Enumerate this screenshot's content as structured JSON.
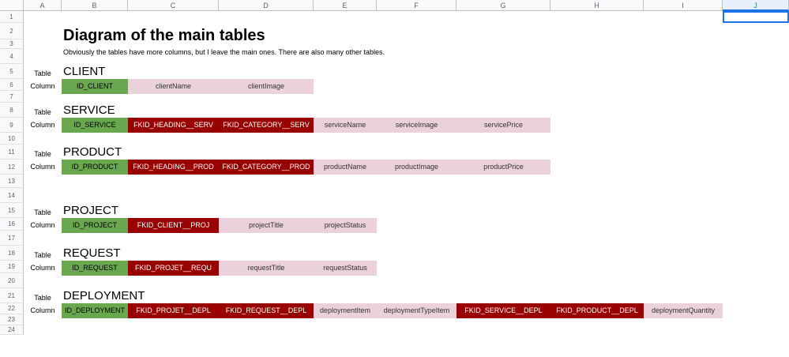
{
  "spreadsheet": {
    "columns": [
      "A",
      "B",
      "C",
      "D",
      "E",
      "F",
      "G",
      "H",
      "I",
      "J"
    ],
    "rows": [
      "1",
      "2",
      "3",
      "4",
      "5",
      "6",
      "7",
      "8",
      "9",
      "10",
      "11",
      "12",
      "13",
      "14",
      "15",
      "16",
      "17",
      "18",
      "19",
      "20",
      "21",
      "22",
      "23",
      "24"
    ],
    "selected_cell": "J1"
  },
  "doc": {
    "title": "Diagram of the main tables",
    "subtitle": "Obviously the tables have more columns, but I leave the main ones. There are also many other tables.",
    "table_label": "Table",
    "column_label": "Column"
  },
  "colors": {
    "primary_key": "#6aa84f",
    "foreign_key": "#990000",
    "column": "#ead1dc"
  },
  "tables": [
    {
      "name": "CLIENT",
      "columns": [
        {
          "text": "ID_CLIENT",
          "kind": "pk"
        },
        {
          "text": "clientName",
          "kind": "col"
        },
        {
          "text": "clientImage",
          "kind": "col"
        }
      ]
    },
    {
      "name": "SERVICE",
      "columns": [
        {
          "text": "ID_SERVICE",
          "kind": "pk"
        },
        {
          "text": "FKID_HEADING__SERV",
          "kind": "fk"
        },
        {
          "text": "FKID_CATEGORY__SERV",
          "kind": "fk"
        },
        {
          "text": "serviceName",
          "kind": "col"
        },
        {
          "text": "serviceImage",
          "kind": "col"
        },
        {
          "text": "servicePrice",
          "kind": "col"
        }
      ]
    },
    {
      "name": "PRODUCT",
      "columns": [
        {
          "text": "ID_PRODUCT",
          "kind": "pk"
        },
        {
          "text": "FKID_HEADING__PROD",
          "kind": "fk"
        },
        {
          "text": "FKID_CATEGORY__PROD",
          "kind": "fk"
        },
        {
          "text": "productName",
          "kind": "col"
        },
        {
          "text": "productImage",
          "kind": "col"
        },
        {
          "text": "productPrice",
          "kind": "col"
        }
      ]
    },
    {
      "name": "PROJECT",
      "columns": [
        {
          "text": "ID_PROJECT",
          "kind": "pk"
        },
        {
          "text": "FKID_CLIENT__PROJ",
          "kind": "fk"
        },
        {
          "text": "projectTitle",
          "kind": "col"
        },
        {
          "text": "projectStatus",
          "kind": "col"
        }
      ]
    },
    {
      "name": "REQUEST",
      "columns": [
        {
          "text": "ID_REQUEST",
          "kind": "pk"
        },
        {
          "text": "FKID_PROJET__REQU",
          "kind": "fk"
        },
        {
          "text": "requestTitle",
          "kind": "col"
        },
        {
          "text": "requestStatus",
          "kind": "col"
        }
      ]
    },
    {
      "name": "DEPLOYMENT",
      "columns": [
        {
          "text": "ID_DEPLOYMENT",
          "kind": "pk"
        },
        {
          "text": "FKID_PROJET__DEPL",
          "kind": "fk"
        },
        {
          "text": "FKID_REQUEST__DEPL",
          "kind": "fk"
        },
        {
          "text": "deploymentItem",
          "kind": "col"
        },
        {
          "text": "deploymentTypeItem",
          "kind": "col"
        },
        {
          "text": "FKID_SERVICE__DEPL",
          "kind": "fk"
        },
        {
          "text": "FKID_PRODUCT__DEPL",
          "kind": "fk"
        },
        {
          "text": "deploymentQuantity",
          "kind": "col"
        }
      ]
    }
  ]
}
